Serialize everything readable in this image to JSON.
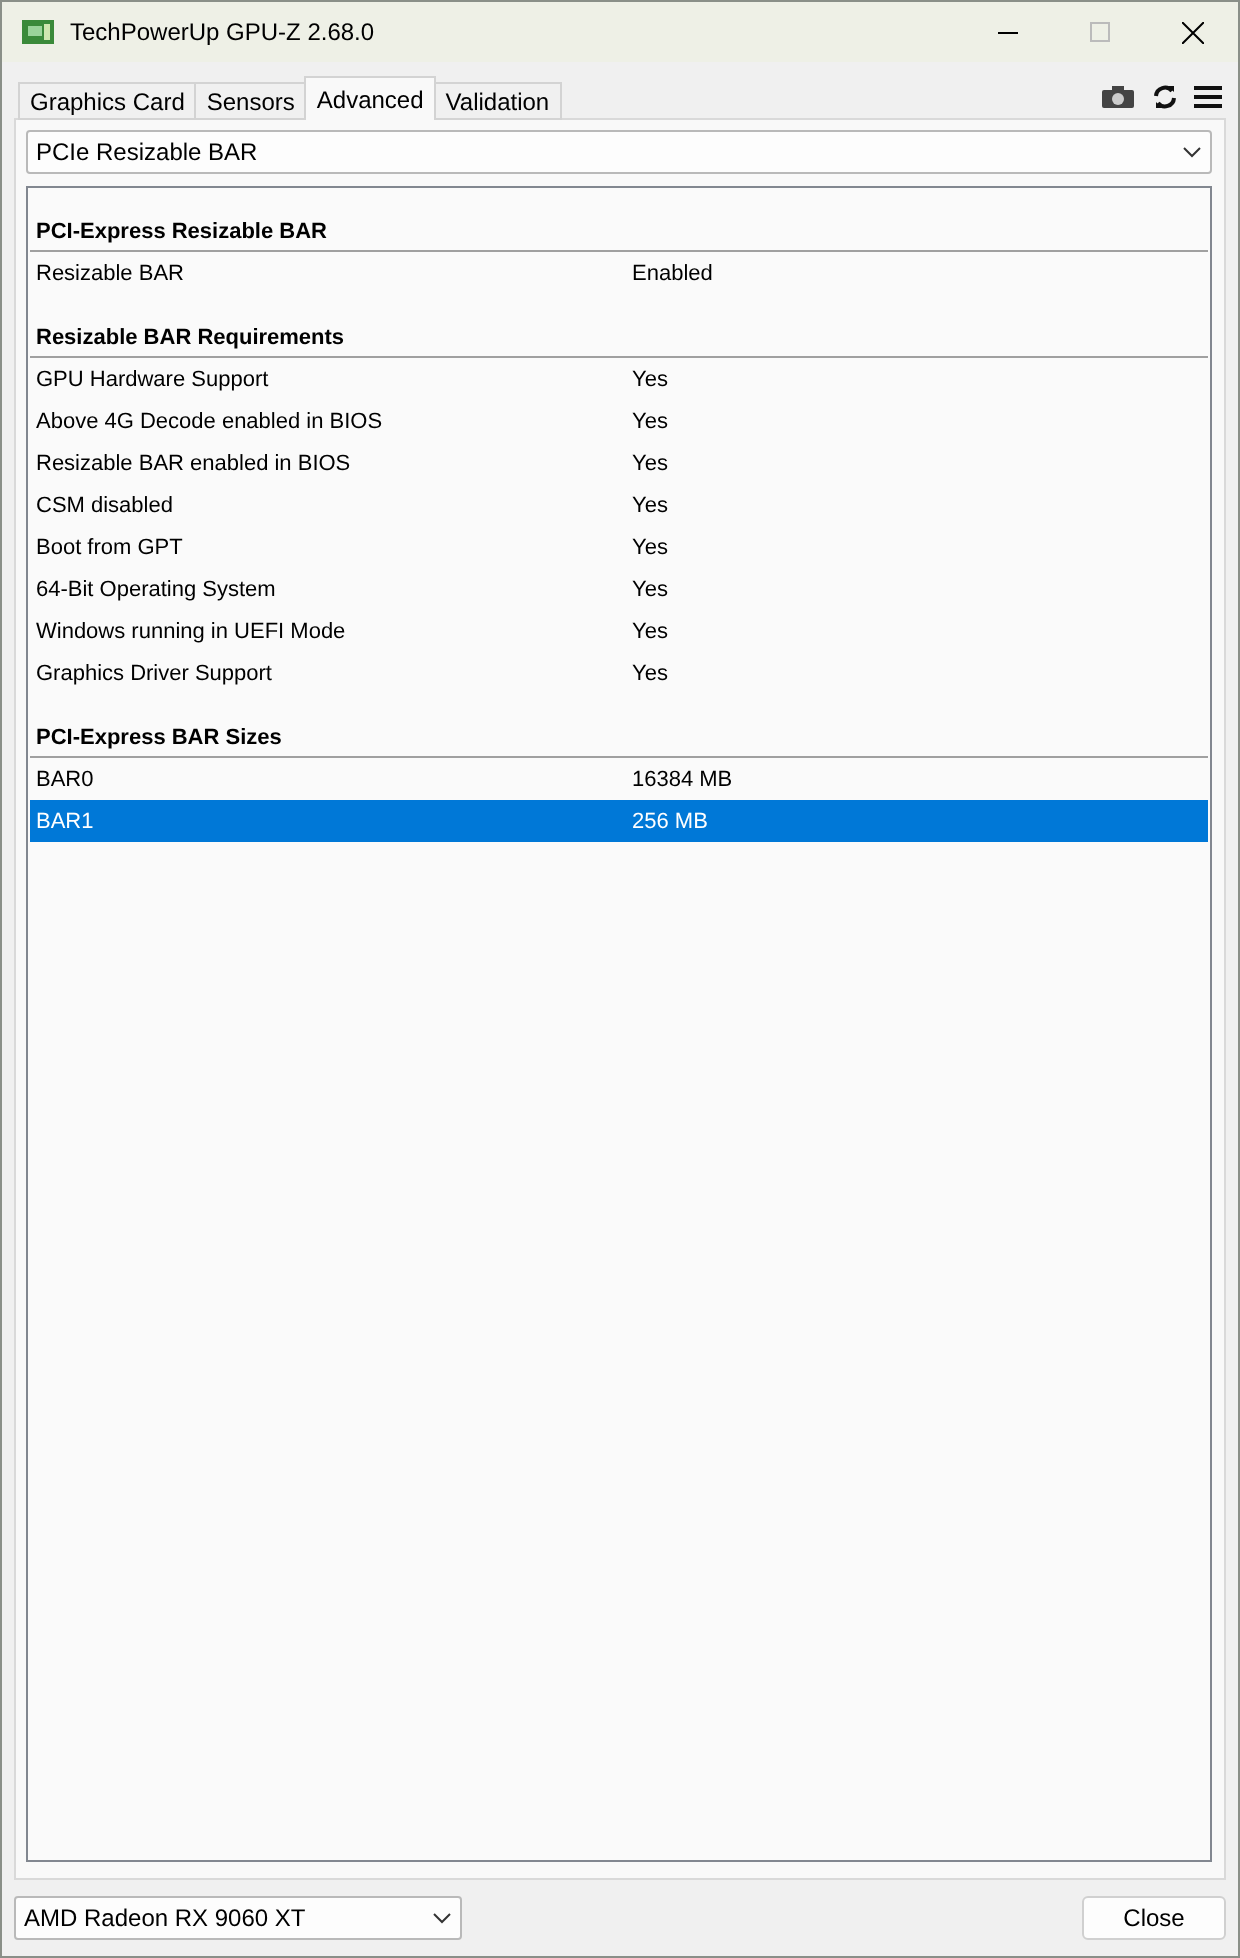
{
  "window": {
    "title": "TechPowerUp GPU-Z 2.68.0"
  },
  "tabs": [
    {
      "label": "Graphics Card",
      "selected": false
    },
    {
      "label": "Sensors",
      "selected": false
    },
    {
      "label": "Advanced",
      "selected": true
    },
    {
      "label": "Validation",
      "selected": false
    }
  ],
  "view_select": {
    "value": "PCIe Resizable BAR"
  },
  "sections": [
    {
      "title": "PCI-Express Resizable BAR",
      "rows": [
        {
          "label": "Resizable BAR",
          "value": "Enabled",
          "selected": false
        }
      ]
    },
    {
      "title": "Resizable BAR Requirements",
      "rows": [
        {
          "label": "GPU Hardware Support",
          "value": "Yes",
          "selected": false
        },
        {
          "label": "Above 4G Decode enabled in BIOS",
          "value": "Yes",
          "selected": false
        },
        {
          "label": "Resizable BAR enabled in BIOS",
          "value": "Yes",
          "selected": false
        },
        {
          "label": "CSM disabled",
          "value": "Yes",
          "selected": false
        },
        {
          "label": "Boot from GPT",
          "value": "Yes",
          "selected": false
        },
        {
          "label": "64-Bit Operating System",
          "value": "Yes",
          "selected": false
        },
        {
          "label": "Windows running in UEFI Mode",
          "value": "Yes",
          "selected": false
        },
        {
          "label": "Graphics Driver Support",
          "value": "Yes",
          "selected": false
        }
      ]
    },
    {
      "title": "PCI-Express BAR Sizes",
      "rows": [
        {
          "label": "BAR0",
          "value": "16384 MB",
          "selected": false
        },
        {
          "label": "BAR1",
          "value": "256 MB",
          "selected": true
        }
      ]
    }
  ],
  "gpu_select": {
    "value": "AMD Radeon RX 9060 XT"
  },
  "close_button": "Close"
}
